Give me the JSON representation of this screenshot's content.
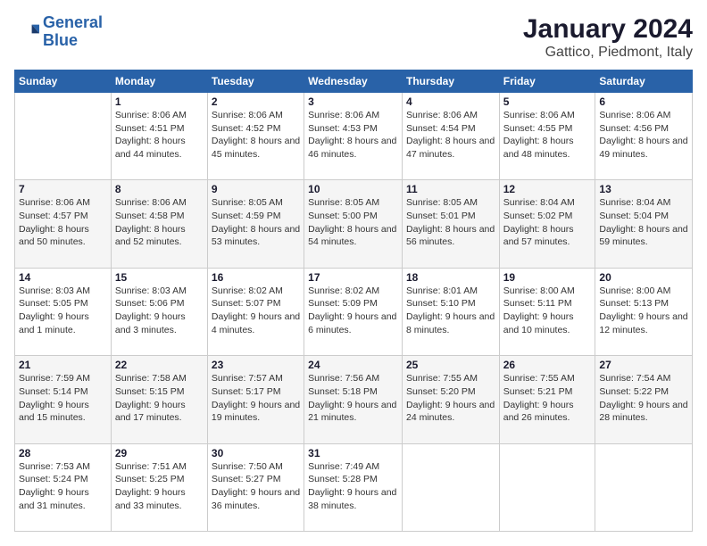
{
  "logo": {
    "line1": "General",
    "line2": "Blue"
  },
  "title": "January 2024",
  "subtitle": "Gattico, Piedmont, Italy",
  "header_days": [
    "Sunday",
    "Monday",
    "Tuesday",
    "Wednesday",
    "Thursday",
    "Friday",
    "Saturday"
  ],
  "weeks": [
    [
      {
        "num": "",
        "sunrise": "",
        "sunset": "",
        "daylight": ""
      },
      {
        "num": "1",
        "sunrise": "Sunrise: 8:06 AM",
        "sunset": "Sunset: 4:51 PM",
        "daylight": "Daylight: 8 hours and 44 minutes."
      },
      {
        "num": "2",
        "sunrise": "Sunrise: 8:06 AM",
        "sunset": "Sunset: 4:52 PM",
        "daylight": "Daylight: 8 hours and 45 minutes."
      },
      {
        "num": "3",
        "sunrise": "Sunrise: 8:06 AM",
        "sunset": "Sunset: 4:53 PM",
        "daylight": "Daylight: 8 hours and 46 minutes."
      },
      {
        "num": "4",
        "sunrise": "Sunrise: 8:06 AM",
        "sunset": "Sunset: 4:54 PM",
        "daylight": "Daylight: 8 hours and 47 minutes."
      },
      {
        "num": "5",
        "sunrise": "Sunrise: 8:06 AM",
        "sunset": "Sunset: 4:55 PM",
        "daylight": "Daylight: 8 hours and 48 minutes."
      },
      {
        "num": "6",
        "sunrise": "Sunrise: 8:06 AM",
        "sunset": "Sunset: 4:56 PM",
        "daylight": "Daylight: 8 hours and 49 minutes."
      }
    ],
    [
      {
        "num": "7",
        "sunrise": "Sunrise: 8:06 AM",
        "sunset": "Sunset: 4:57 PM",
        "daylight": "Daylight: 8 hours and 50 minutes."
      },
      {
        "num": "8",
        "sunrise": "Sunrise: 8:06 AM",
        "sunset": "Sunset: 4:58 PM",
        "daylight": "Daylight: 8 hours and 52 minutes."
      },
      {
        "num": "9",
        "sunrise": "Sunrise: 8:05 AM",
        "sunset": "Sunset: 4:59 PM",
        "daylight": "Daylight: 8 hours and 53 minutes."
      },
      {
        "num": "10",
        "sunrise": "Sunrise: 8:05 AM",
        "sunset": "Sunset: 5:00 PM",
        "daylight": "Daylight: 8 hours and 54 minutes."
      },
      {
        "num": "11",
        "sunrise": "Sunrise: 8:05 AM",
        "sunset": "Sunset: 5:01 PM",
        "daylight": "Daylight: 8 hours and 56 minutes."
      },
      {
        "num": "12",
        "sunrise": "Sunrise: 8:04 AM",
        "sunset": "Sunset: 5:02 PM",
        "daylight": "Daylight: 8 hours and 57 minutes."
      },
      {
        "num": "13",
        "sunrise": "Sunrise: 8:04 AM",
        "sunset": "Sunset: 5:04 PM",
        "daylight": "Daylight: 8 hours and 59 minutes."
      }
    ],
    [
      {
        "num": "14",
        "sunrise": "Sunrise: 8:03 AM",
        "sunset": "Sunset: 5:05 PM",
        "daylight": "Daylight: 9 hours and 1 minute."
      },
      {
        "num": "15",
        "sunrise": "Sunrise: 8:03 AM",
        "sunset": "Sunset: 5:06 PM",
        "daylight": "Daylight: 9 hours and 3 minutes."
      },
      {
        "num": "16",
        "sunrise": "Sunrise: 8:02 AM",
        "sunset": "Sunset: 5:07 PM",
        "daylight": "Daylight: 9 hours and 4 minutes."
      },
      {
        "num": "17",
        "sunrise": "Sunrise: 8:02 AM",
        "sunset": "Sunset: 5:09 PM",
        "daylight": "Daylight: 9 hours and 6 minutes."
      },
      {
        "num": "18",
        "sunrise": "Sunrise: 8:01 AM",
        "sunset": "Sunset: 5:10 PM",
        "daylight": "Daylight: 9 hours and 8 minutes."
      },
      {
        "num": "19",
        "sunrise": "Sunrise: 8:00 AM",
        "sunset": "Sunset: 5:11 PM",
        "daylight": "Daylight: 9 hours and 10 minutes."
      },
      {
        "num": "20",
        "sunrise": "Sunrise: 8:00 AM",
        "sunset": "Sunset: 5:13 PM",
        "daylight": "Daylight: 9 hours and 12 minutes."
      }
    ],
    [
      {
        "num": "21",
        "sunrise": "Sunrise: 7:59 AM",
        "sunset": "Sunset: 5:14 PM",
        "daylight": "Daylight: 9 hours and 15 minutes."
      },
      {
        "num": "22",
        "sunrise": "Sunrise: 7:58 AM",
        "sunset": "Sunset: 5:15 PM",
        "daylight": "Daylight: 9 hours and 17 minutes."
      },
      {
        "num": "23",
        "sunrise": "Sunrise: 7:57 AM",
        "sunset": "Sunset: 5:17 PM",
        "daylight": "Daylight: 9 hours and 19 minutes."
      },
      {
        "num": "24",
        "sunrise": "Sunrise: 7:56 AM",
        "sunset": "Sunset: 5:18 PM",
        "daylight": "Daylight: 9 hours and 21 minutes."
      },
      {
        "num": "25",
        "sunrise": "Sunrise: 7:55 AM",
        "sunset": "Sunset: 5:20 PM",
        "daylight": "Daylight: 9 hours and 24 minutes."
      },
      {
        "num": "26",
        "sunrise": "Sunrise: 7:55 AM",
        "sunset": "Sunset: 5:21 PM",
        "daylight": "Daylight: 9 hours and 26 minutes."
      },
      {
        "num": "27",
        "sunrise": "Sunrise: 7:54 AM",
        "sunset": "Sunset: 5:22 PM",
        "daylight": "Daylight: 9 hours and 28 minutes."
      }
    ],
    [
      {
        "num": "28",
        "sunrise": "Sunrise: 7:53 AM",
        "sunset": "Sunset: 5:24 PM",
        "daylight": "Daylight: 9 hours and 31 minutes."
      },
      {
        "num": "29",
        "sunrise": "Sunrise: 7:51 AM",
        "sunset": "Sunset: 5:25 PM",
        "daylight": "Daylight: 9 hours and 33 minutes."
      },
      {
        "num": "30",
        "sunrise": "Sunrise: 7:50 AM",
        "sunset": "Sunset: 5:27 PM",
        "daylight": "Daylight: 9 hours and 36 minutes."
      },
      {
        "num": "31",
        "sunrise": "Sunrise: 7:49 AM",
        "sunset": "Sunset: 5:28 PM",
        "daylight": "Daylight: 9 hours and 38 minutes."
      },
      {
        "num": "",
        "sunrise": "",
        "sunset": "",
        "daylight": ""
      },
      {
        "num": "",
        "sunrise": "",
        "sunset": "",
        "daylight": ""
      },
      {
        "num": "",
        "sunrise": "",
        "sunset": "",
        "daylight": ""
      }
    ]
  ]
}
